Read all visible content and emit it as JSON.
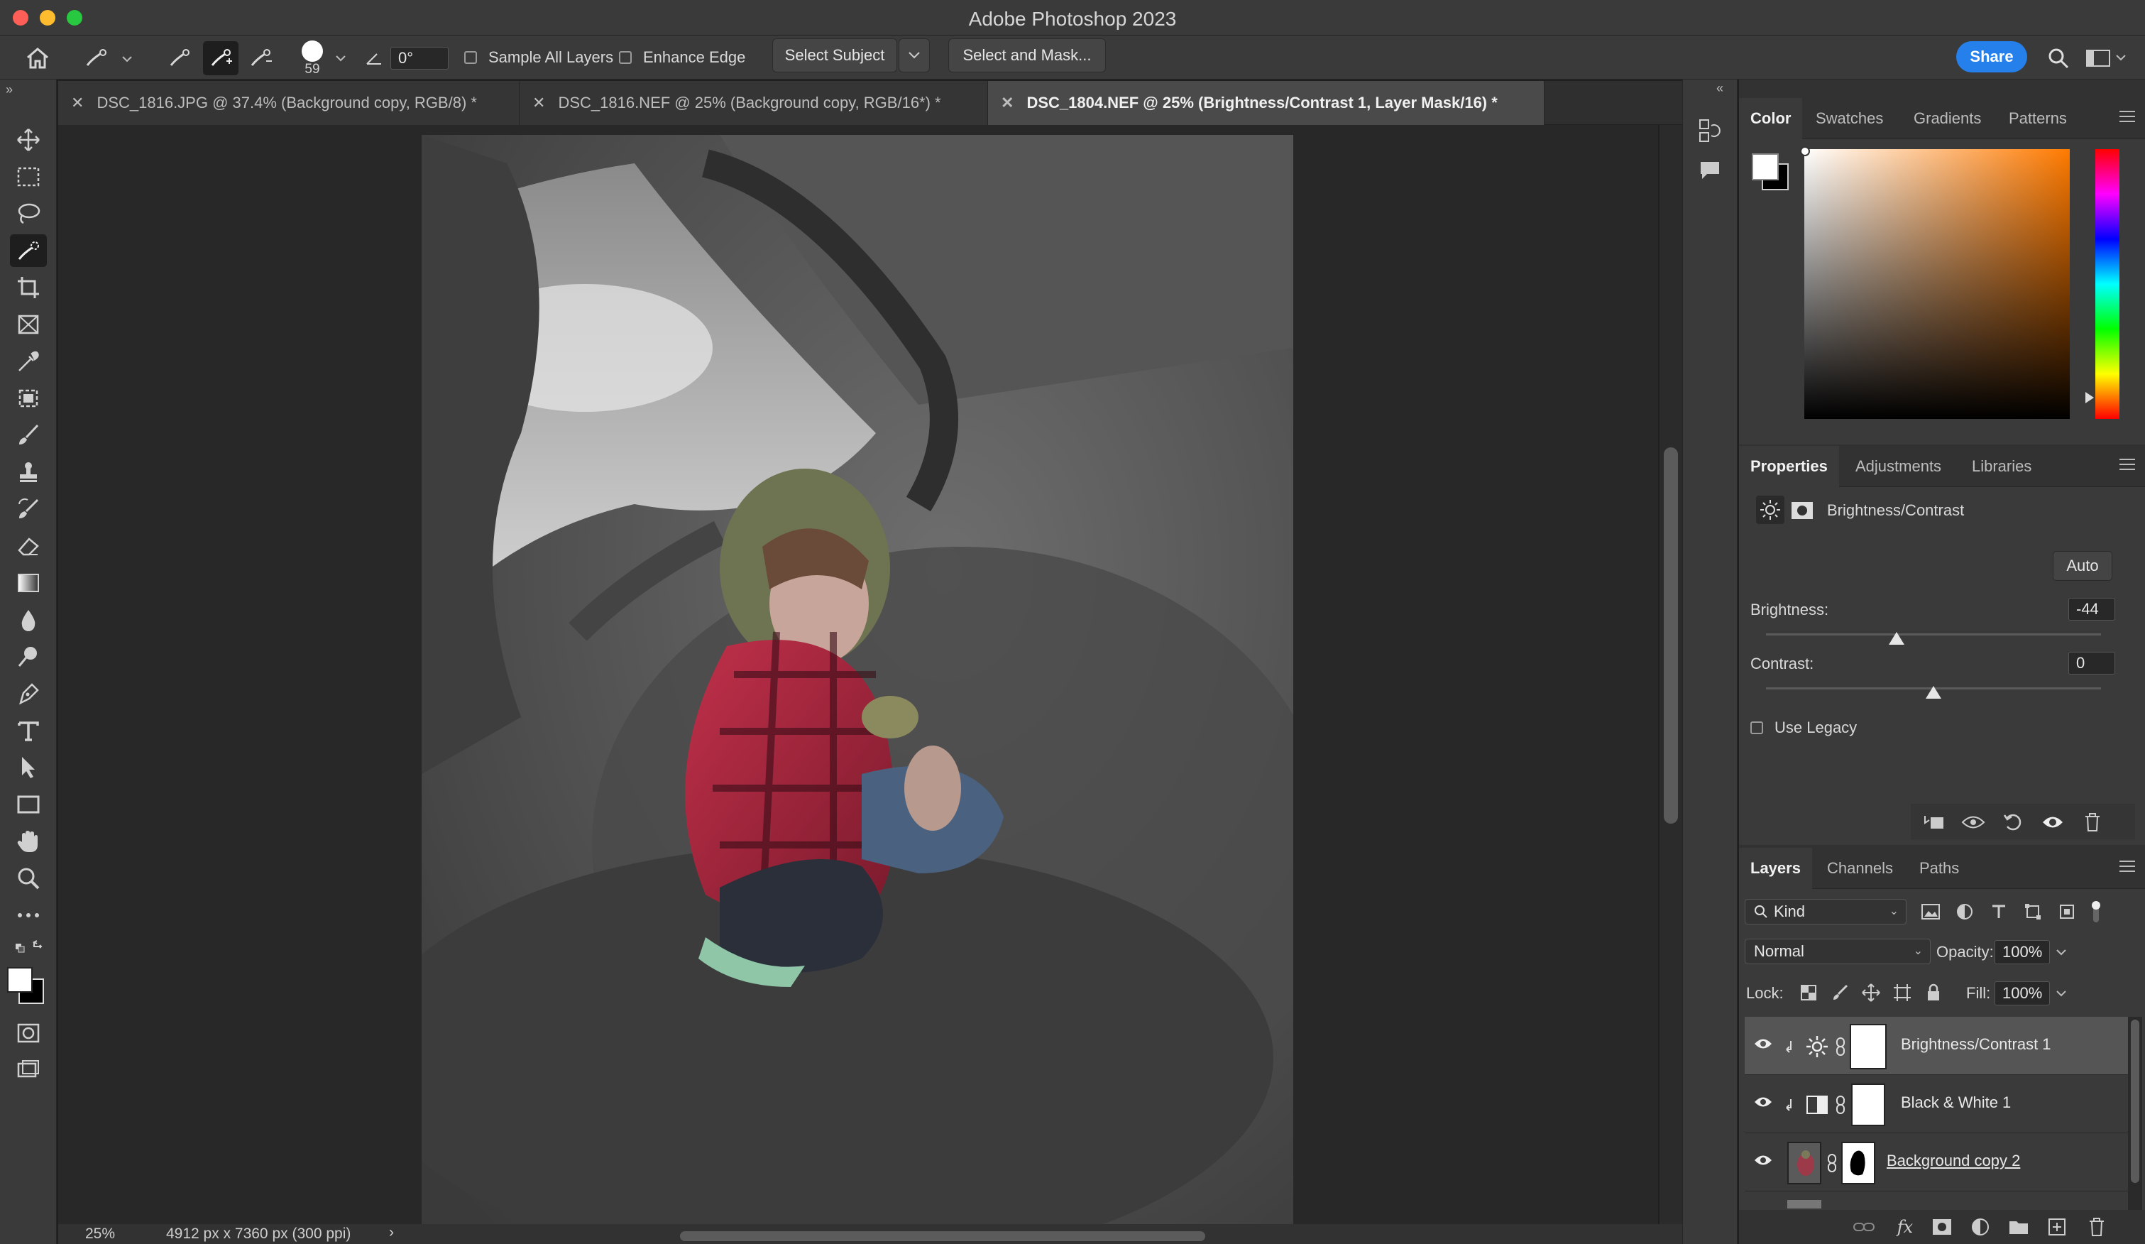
{
  "app": {
    "title": "Adobe Photoshop 2023"
  },
  "options_bar": {
    "brush_size": "59",
    "angle": "0°",
    "sample_all_layers": "Sample All Layers",
    "enhance_edge": "Enhance Edge",
    "select_subject": "Select Subject",
    "select_and_mask": "Select and Mask...",
    "share": "Share"
  },
  "doc_tabs": [
    {
      "label": "DSC_1816.JPG @ 37.4% (Background copy, RGB/8) *",
      "active": false
    },
    {
      "label": "DSC_1816.NEF @ 25% (Background copy, RGB/16*) *",
      "active": false
    },
    {
      "label": "DSC_1804.NEF @ 25% (Brightness/Contrast 1, Layer Mask/16) *",
      "active": true
    }
  ],
  "tools": [
    "move-tool",
    "marquee-tool",
    "lasso-tool",
    "quick-selection-tool",
    "crop-tool",
    "frame-tool",
    "eyedropper-tool",
    "healing-brush-tool",
    "brush-tool",
    "clone-stamp-tool",
    "history-brush-tool",
    "eraser-tool",
    "gradient-tool",
    "blur-tool",
    "dodge-tool",
    "pen-tool",
    "type-tool",
    "path-selection-tool",
    "rectangle-tool",
    "hand-tool",
    "zoom-tool",
    "more-tools"
  ],
  "status": {
    "zoom": "25%",
    "doc_info": "4912 px x 7360 px (300 ppi)",
    "arrow": "›"
  },
  "color_panel": {
    "tabs": [
      "Color",
      "Swatches",
      "Gradients",
      "Patterns"
    ],
    "active_tab": "Color"
  },
  "properties_panel": {
    "tabs": [
      "Properties",
      "Adjustments",
      "Libraries"
    ],
    "active_tab": "Properties",
    "adjustment_name": "Brightness/Contrast",
    "auto_label": "Auto",
    "brightness_label": "Brightness:",
    "brightness_value": "-44",
    "brightness_fraction": 0.39,
    "contrast_label": "Contrast:",
    "contrast_value": "0",
    "contrast_fraction": 0.5,
    "use_legacy": "Use Legacy"
  },
  "layers_panel": {
    "tabs": [
      "Layers",
      "Channels",
      "Paths"
    ],
    "active_tab": "Layers",
    "kind_label": "Kind",
    "blend_mode": "Normal",
    "opacity_label": "Opacity:",
    "opacity_value": "100%",
    "lock_label": "Lock:",
    "fill_label": "Fill:",
    "fill_value": "100%",
    "layers": [
      {
        "name": "Brightness/Contrast 1",
        "type": "adjustment",
        "icon": "sun-icon",
        "selected": true,
        "underlined": false
      },
      {
        "name": "Black & White 1",
        "type": "adjustment",
        "icon": "black-white-icon",
        "selected": false,
        "underlined": false
      },
      {
        "name": "Background copy 2",
        "type": "pixel",
        "icon": "photo-thumb",
        "selected": false,
        "underlined": true
      }
    ]
  },
  "colors": {
    "share_blue": "#2680eb",
    "panel_bg": "#3a3a3a",
    "selected_layer": "#555555"
  }
}
